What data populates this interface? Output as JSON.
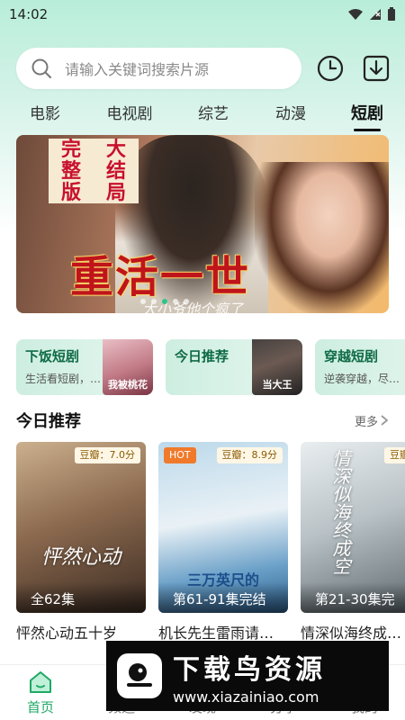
{
  "status": {
    "time": "14:02"
  },
  "search": {
    "placeholder": "请输入关键词搜索片源"
  },
  "tabs": [
    {
      "label": "电影",
      "active": false
    },
    {
      "label": "电视剧",
      "active": false
    },
    {
      "label": "综艺",
      "active": false
    },
    {
      "label": "动漫",
      "active": false
    },
    {
      "label": "短剧",
      "active": true
    }
  ],
  "banner": {
    "seal": [
      "完",
      "大",
      "整",
      "结",
      "版",
      "局"
    ],
    "title": "重活一世",
    "subtitle": "大小爷他个疯了",
    "dots": 5,
    "active_dot": 2
  },
  "categories": [
    {
      "title": "下饭短剧",
      "desc": "生活看短剧，…",
      "thumb_text": "我被桃花"
    },
    {
      "title": "今日推荐",
      "desc": "",
      "thumb_text": "当大王"
    },
    {
      "title": "穿越短剧",
      "desc": "逆袭穿越，尽…",
      "thumb_text": ""
    }
  ],
  "today": {
    "title": "今日推荐",
    "more": "更多",
    "items": [
      {
        "title": "怦然心动五十岁",
        "rating": "豆瓣：7.0分",
        "episodes": "全62集",
        "hot": false,
        "art": "怦然心动"
      },
      {
        "title": "机长先生雷雨请…",
        "rating": "豆瓣：8.9分",
        "episodes": "第61-91集完结",
        "hot": true,
        "hot_label": "HOT",
        "art": "三万英尺的"
      },
      {
        "title": "情深似海终成…",
        "rating": "豆瓣：",
        "episodes": "第21-30集完",
        "hot": false,
        "art": "情深似海终成空"
      }
    ]
  },
  "nav": [
    {
      "label": "首页",
      "active": true,
      "icon": "home-icon"
    },
    {
      "label": "频道",
      "active": false,
      "icon": "channel-icon"
    },
    {
      "label": "发现",
      "active": false,
      "icon": "discover-icon"
    },
    {
      "label": "分享",
      "active": false,
      "icon": "share-icon"
    },
    {
      "label": "我的",
      "active": false,
      "icon": "profile-icon"
    }
  ],
  "watermark": {
    "title": "下载鸟资源",
    "url": "www.xiazainiao.com"
  },
  "colors": {
    "accent": "#1ea866",
    "tab_underline": "#111111",
    "hot": "#f07a2b"
  }
}
